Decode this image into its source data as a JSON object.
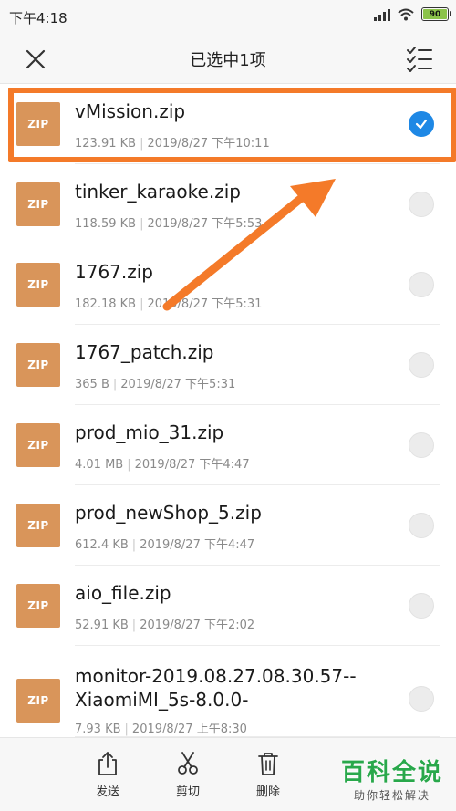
{
  "status_bar": {
    "time": "下午4:18",
    "battery_level": "90",
    "battery_color": "#8bc34a"
  },
  "header": {
    "title": "已选中1项",
    "close_icon": "close-icon",
    "select_all_icon": "checklist-icon"
  },
  "files": [
    {
      "thumb": "ZIP",
      "name": "vMission.zip",
      "size": "123.91 KB",
      "date": "2019/8/27 下午10:11",
      "selected": true
    },
    {
      "thumb": "ZIP",
      "name": "tinker_karaoke.zip",
      "size": "118.59 KB",
      "date": "2019/8/27 下午5:53",
      "selected": false
    },
    {
      "thumb": "ZIP",
      "name": "1767.zip",
      "size": "182.18 KB",
      "date": "2019/8/27 下午5:31",
      "selected": false
    },
    {
      "thumb": "ZIP",
      "name": "1767_patch.zip",
      "size": "365 B",
      "date": "2019/8/27 下午5:31",
      "selected": false
    },
    {
      "thumb": "ZIP",
      "name": "prod_mio_31.zip",
      "size": "4.01 MB",
      "date": "2019/8/27 下午4:47",
      "selected": false
    },
    {
      "thumb": "ZIP",
      "name": "prod_newShop_5.zip",
      "size": "612.4 KB",
      "date": "2019/8/27 下午4:47",
      "selected": false
    },
    {
      "thumb": "ZIP",
      "name": "aio_file.zip",
      "size": "52.91 KB",
      "date": "2019/8/27 下午2:02",
      "selected": false
    },
    {
      "thumb": "ZIP",
      "name": "monitor-2019.08.27.08.30.57--XiaomiMI_5s-8.0.0-8697180254639…",
      "size": "7.93 KB",
      "date": "2019/8/27 上午8:30",
      "selected": false
    }
  ],
  "bottom_actions": [
    {
      "label": "发送",
      "icon": "share-icon"
    },
    {
      "label": "剪切",
      "icon": "scissors-icon"
    },
    {
      "label": "删除",
      "icon": "trash-icon"
    }
  ],
  "watermark": {
    "main": "百科全说",
    "sub": "助你轻松解决"
  },
  "colors": {
    "accent_blue": "#1e88e5",
    "highlight_orange": "#f47a29",
    "zip_thumb": "#d9955a"
  }
}
